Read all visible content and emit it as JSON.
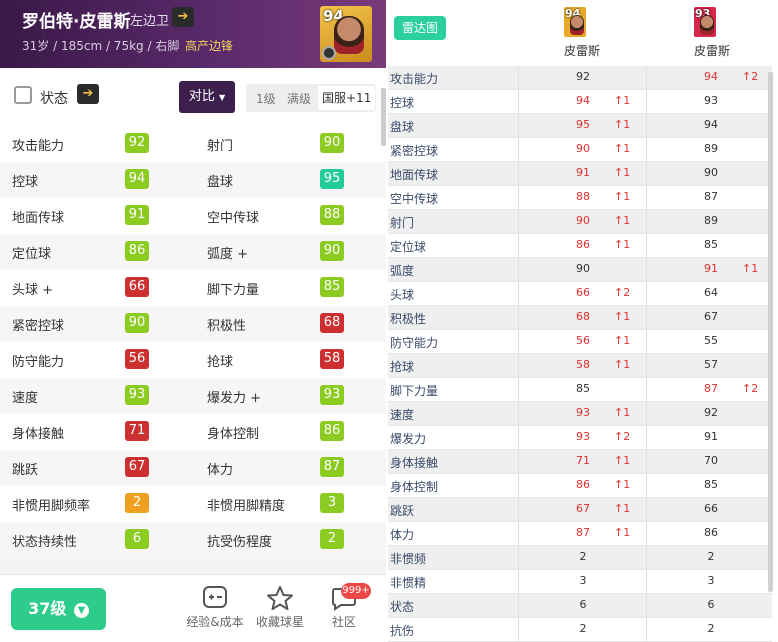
{
  "player": {
    "name": "罗伯特·皮雷斯",
    "position": "左边卫",
    "info": "31岁 / 185cm / 75kg / 右脚",
    "tag": "高产边锋",
    "rating": "94"
  },
  "strip": {
    "title": "状态",
    "compare_label": "对比",
    "level_options": [
      "1级",
      "满级",
      "国服+11"
    ],
    "selected_level": "国服+11"
  },
  "colors": {
    "green": "#8ccc22",
    "teal": "#22cc99",
    "red": "#cc3030",
    "orange": "#f0a020",
    "lime": "#8ccc22"
  },
  "stats": [
    [
      {
        "label": "攻击能力",
        "value": "92",
        "color": "lime"
      },
      {
        "label": "射门",
        "value": "90",
        "color": "lime"
      }
    ],
    [
      {
        "label": "控球",
        "value": "94",
        "color": "lime"
      },
      {
        "label": "盘球",
        "value": "95",
        "color": "teal"
      }
    ],
    [
      {
        "label": "地面传球",
        "value": "91",
        "color": "lime"
      },
      {
        "label": "空中传球",
        "value": "88",
        "color": "lime"
      }
    ],
    [
      {
        "label": "定位球",
        "value": "86",
        "color": "lime"
      },
      {
        "label": "弧度 +",
        "value": "90",
        "color": "lime"
      }
    ],
    [
      {
        "label": "头球 +",
        "value": "66",
        "color": "red"
      },
      {
        "label": "脚下力量",
        "value": "85",
        "color": "lime"
      }
    ],
    [
      {
        "label": "紧密控球",
        "value": "90",
        "color": "lime"
      },
      {
        "label": "积极性",
        "value": "68",
        "color": "red"
      }
    ],
    [
      {
        "label": "防守能力",
        "value": "56",
        "color": "red"
      },
      {
        "label": "抢球",
        "value": "58",
        "color": "red"
      }
    ],
    [
      {
        "label": "速度",
        "value": "93",
        "color": "lime"
      },
      {
        "label": "爆发力 +",
        "value": "93",
        "color": "lime"
      }
    ],
    [
      {
        "label": "身体接触",
        "value": "71",
        "color": "red"
      },
      {
        "label": "身体控制",
        "value": "86",
        "color": "lime"
      }
    ],
    [
      {
        "label": "跳跃",
        "value": "67",
        "color": "red"
      },
      {
        "label": "体力",
        "value": "87",
        "color": "lime"
      }
    ],
    [
      {
        "label": "非惯用脚频率",
        "value": "2",
        "color": "orange"
      },
      {
        "label": "非惯用脚精度",
        "value": "3",
        "color": "lime"
      }
    ],
    [
      {
        "label": "状态持续性",
        "value": "6",
        "color": "lime"
      },
      {
        "label": "抗受伤程度",
        "value": "2",
        "color": "lime"
      }
    ]
  ],
  "bottom": {
    "level_button": "37级",
    "tabs": [
      {
        "label": "经验&成本",
        "icon": "calculator-icon"
      },
      {
        "label": "收藏球星",
        "icon": "star-icon"
      },
      {
        "label": "社区",
        "icon": "chat-icon"
      }
    ],
    "badge": "999+"
  },
  "compare": {
    "radar_button": "雷达图",
    "players": [
      {
        "name": "皮雷斯",
        "rating": "94",
        "card_color": "#e8a828"
      },
      {
        "name": "皮雷斯",
        "rating": "93",
        "card_color": "#d6264a"
      }
    ],
    "rows": [
      {
        "label": "攻击能力",
        "v1": "92",
        "a1": "",
        "v2": "94",
        "a2": "↑2",
        "w": 2
      },
      {
        "label": "控球",
        "v1": "94",
        "a1": "↑1",
        "v2": "93",
        "a2": "",
        "w": 1
      },
      {
        "label": "盘球",
        "v1": "95",
        "a1": "↑1",
        "v2": "94",
        "a2": "",
        "w": 1
      },
      {
        "label": "紧密控球",
        "v1": "90",
        "a1": "↑1",
        "v2": "89",
        "a2": "",
        "w": 1
      },
      {
        "label": "地面传球",
        "v1": "91",
        "a1": "↑1",
        "v2": "90",
        "a2": "",
        "w": 1
      },
      {
        "label": "空中传球",
        "v1": "88",
        "a1": "↑1",
        "v2": "87",
        "a2": "",
        "w": 1
      },
      {
        "label": "射门",
        "v1": "90",
        "a1": "↑1",
        "v2": "89",
        "a2": "",
        "w": 1
      },
      {
        "label": "定位球",
        "v1": "86",
        "a1": "↑1",
        "v2": "85",
        "a2": "",
        "w": 1
      },
      {
        "label": "弧度",
        "v1": "90",
        "a1": "",
        "v2": "91",
        "a2": "↑1",
        "w": 2
      },
      {
        "label": "头球",
        "v1": "66",
        "a1": "↑2",
        "v2": "64",
        "a2": "",
        "w": 1
      },
      {
        "label": "积极性",
        "v1": "68",
        "a1": "↑1",
        "v2": "67",
        "a2": "",
        "w": 1
      },
      {
        "label": "防守能力",
        "v1": "56",
        "a1": "↑1",
        "v2": "55",
        "a2": "",
        "w": 1
      },
      {
        "label": "抢球",
        "v1": "58",
        "a1": "↑1",
        "v2": "57",
        "a2": "",
        "w": 1
      },
      {
        "label": "脚下力量",
        "v1": "85",
        "a1": "",
        "v2": "87",
        "a2": "↑2",
        "w": 2
      },
      {
        "label": "速度",
        "v1": "93",
        "a1": "↑1",
        "v2": "92",
        "a2": "",
        "w": 1
      },
      {
        "label": "爆发力",
        "v1": "93",
        "a1": "↑2",
        "v2": "91",
        "a2": "",
        "w": 1
      },
      {
        "label": "身体接触",
        "v1": "71",
        "a1": "↑1",
        "v2": "70",
        "a2": "",
        "w": 1
      },
      {
        "label": "身体控制",
        "v1": "86",
        "a1": "↑1",
        "v2": "85",
        "a2": "",
        "w": 1
      },
      {
        "label": "跳跃",
        "v1": "67",
        "a1": "↑1",
        "v2": "66",
        "a2": "",
        "w": 1
      },
      {
        "label": "体力",
        "v1": "87",
        "a1": "↑1",
        "v2": "86",
        "a2": "",
        "w": 1
      },
      {
        "label": "非惯频",
        "v1": "2",
        "a1": "",
        "v2": "2",
        "a2": "",
        "w": 0
      },
      {
        "label": "非惯精",
        "v1": "3",
        "a1": "",
        "v2": "3",
        "a2": "",
        "w": 0
      },
      {
        "label": "状态",
        "v1": "6",
        "a1": "",
        "v2": "6",
        "a2": "",
        "w": 0
      },
      {
        "label": "抗伤",
        "v1": "2",
        "a1": "",
        "v2": "2",
        "a2": "",
        "w": 0
      }
    ]
  }
}
